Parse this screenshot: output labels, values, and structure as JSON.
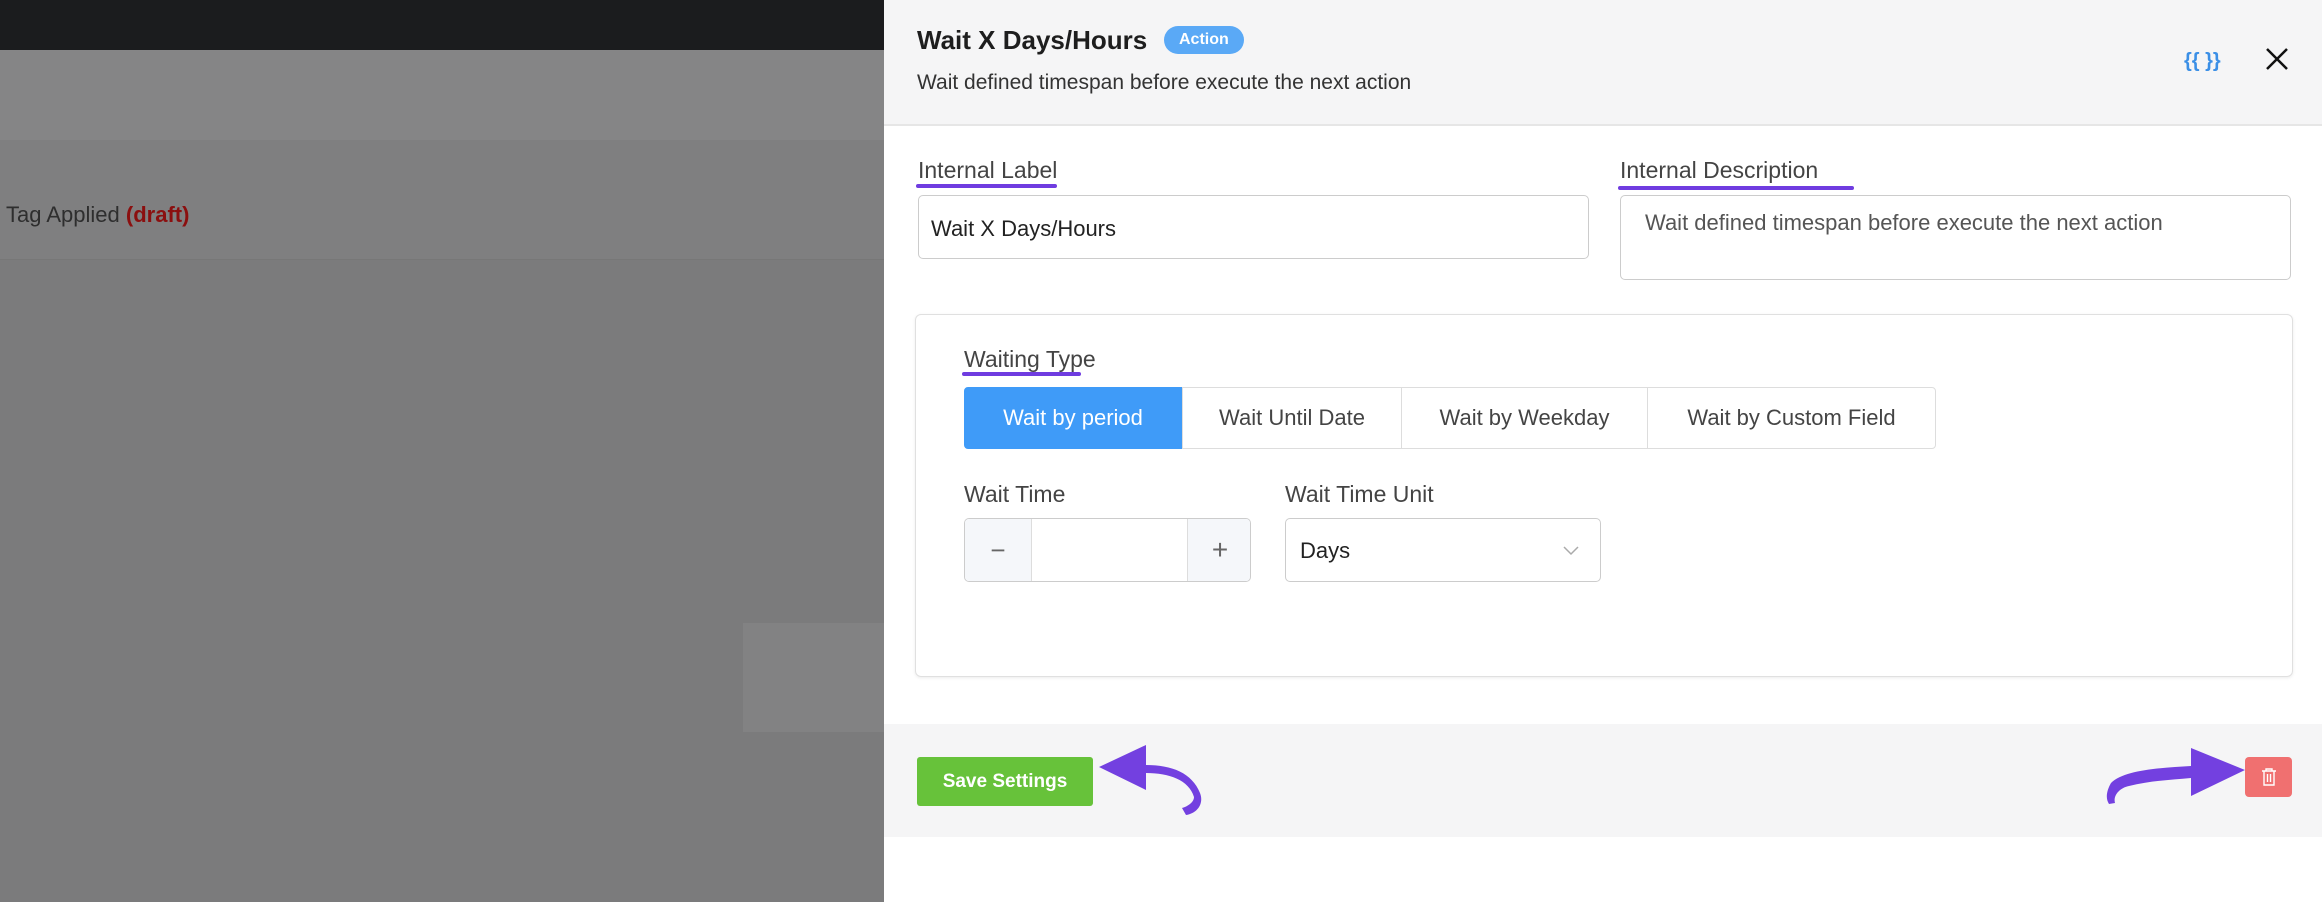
{
  "background": {
    "text": "Tag Applied",
    "status": "(draft)"
  },
  "panel": {
    "title": "Wait X Days/Hours",
    "badge": "Action",
    "subtitle": "Wait defined timespan before execute the next action",
    "smartcode_label": "{{ }}",
    "close_icon": "close-icon"
  },
  "form": {
    "internal_label": {
      "label": "Internal Label",
      "value": "Wait X Days/Hours"
    },
    "internal_description": {
      "label": "Internal Description",
      "value": "Wait defined timespan before execute the next action"
    },
    "waiting_type": {
      "label": "Waiting Type",
      "tabs": [
        "Wait by period",
        "Wait Until Date",
        "Wait by Weekday",
        "Wait by Custom Field"
      ],
      "active": "Wait by period"
    },
    "wait_time": {
      "label": "Wait Time",
      "value": "",
      "minus": "−",
      "plus": "+"
    },
    "wait_time_unit": {
      "label": "Wait Time Unit",
      "value": "Days"
    }
  },
  "footer": {
    "save_label": "Save Settings",
    "delete_icon": "trash-icon"
  },
  "colors": {
    "accent": "#3f9bf8",
    "save": "#67c23a",
    "delete": "#f07070",
    "annotation": "#6f3ce0"
  }
}
